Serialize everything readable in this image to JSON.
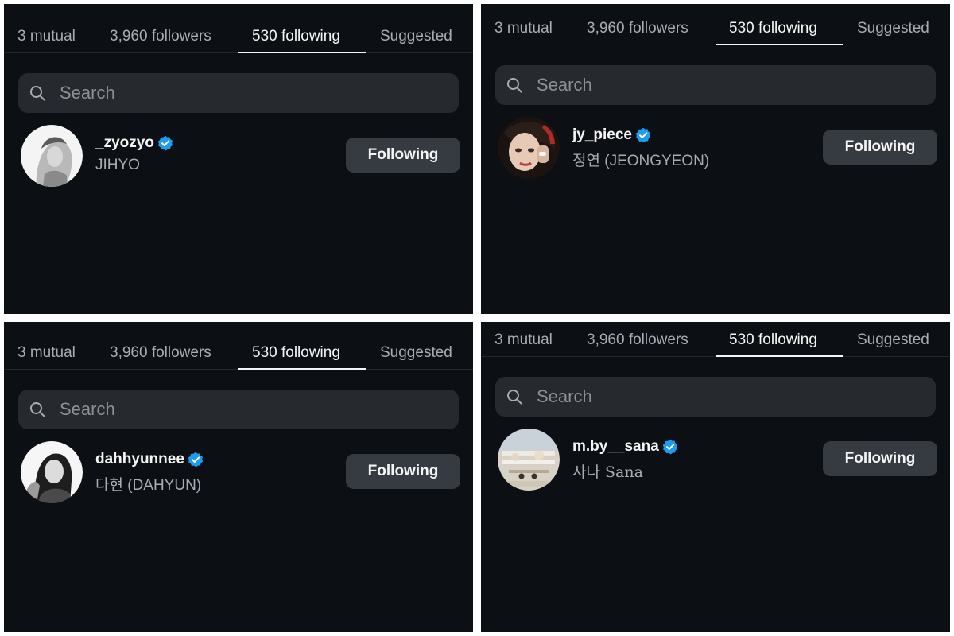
{
  "tabs": {
    "mutual": "3 mutual",
    "followers": "3,960 followers",
    "following": "530 following",
    "suggested": "Suggested",
    "active": "following"
  },
  "search": {
    "placeholder": "Search"
  },
  "colors": {
    "background": "#0c1014",
    "search_bg": "#262a2f",
    "button_bg": "#363b41",
    "verified": "#1d9bf0",
    "secondary_text": "#a8adb3"
  },
  "panels": [
    {
      "username": "_zyozyo",
      "full_name": "JIHYO",
      "verified": true,
      "button_label": "Following",
      "avatar_icon": "profile-photo"
    },
    {
      "username": "jy_piece",
      "full_name": "정연 (JEONGYEON)",
      "verified": true,
      "button_label": "Following",
      "avatar_icon": "profile-photo"
    },
    {
      "username": "dahhyunnee",
      "full_name": "다현 (DAHYUN)",
      "verified": true,
      "button_label": "Following",
      "avatar_icon": "profile-photo"
    },
    {
      "username": "m.by__sana",
      "full_name": "사나 Sana",
      "verified": true,
      "button_label": "Following",
      "avatar_icon": "profile-photo"
    }
  ]
}
